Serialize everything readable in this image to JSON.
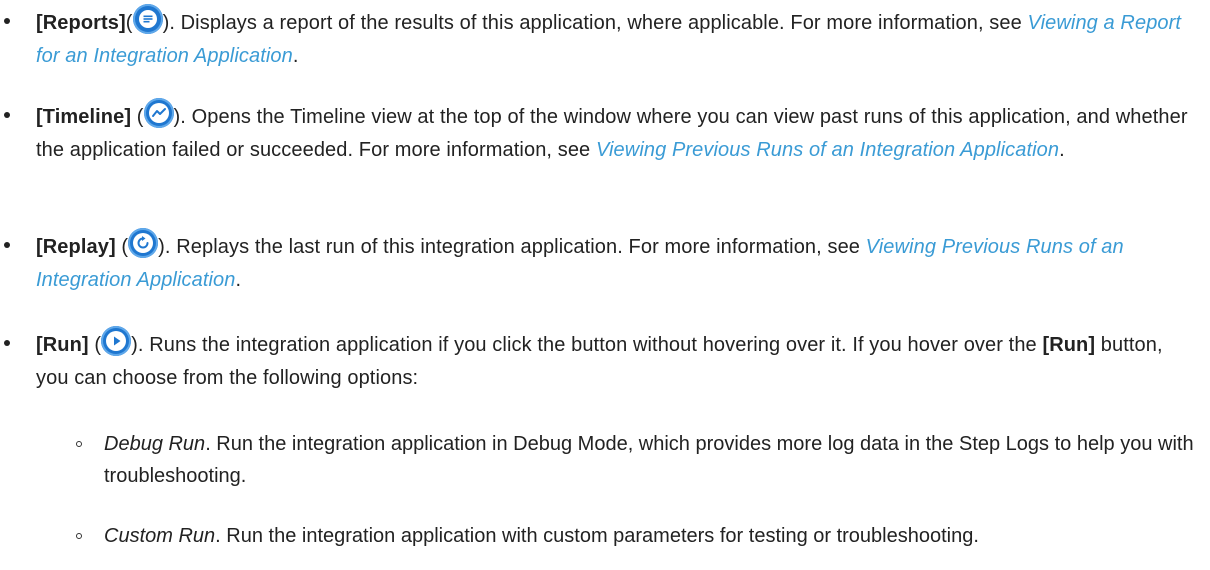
{
  "items": [
    {
      "label": "[Reports]",
      "open": "(",
      "after_icon": "). Displays a report of the results of this application, where applicable. For more information, see ",
      "link": "Viewing a Report for an Integration Application",
      "end": ".",
      "icon": "reports-icon"
    },
    {
      "label": "[Timeline]",
      "open": " (",
      "after_icon": "). Opens the Timeline view at the top of the window where you can view past runs of this application, and whether the application failed or succeeded. For more information, see ",
      "link": "Viewing Previous Runs of an Integration Application",
      "end": ".",
      "icon": "timeline-icon"
    },
    {
      "label": "[Replay]",
      "open": " (",
      "after_icon": "). Replays the last run of this integration application. For more information, see ",
      "link": "Viewing Previous Runs of an Integration Application",
      "end": ".",
      "icon": "replay-icon"
    },
    {
      "label": "[Run]",
      "open": " (",
      "after_icon": "). Runs the integration application if you click the button without hovering over it. If you hover over the ",
      "label2": "[Run]",
      "tail": " button, you can choose from the following options:",
      "icon": "play-icon"
    }
  ],
  "subitems": [
    {
      "name": "Debug Run",
      "text": ". Run the integration application in Debug Mode, which provides more log data in the Step Logs to help you with troubleshooting."
    },
    {
      "name": "Custom Run",
      "text": ". Run the integration application with custom parameters for testing or troubleshooting."
    }
  ],
  "colors": {
    "text": "#222222",
    "link": "#3a9bd5",
    "icon": "#1f77d0"
  }
}
